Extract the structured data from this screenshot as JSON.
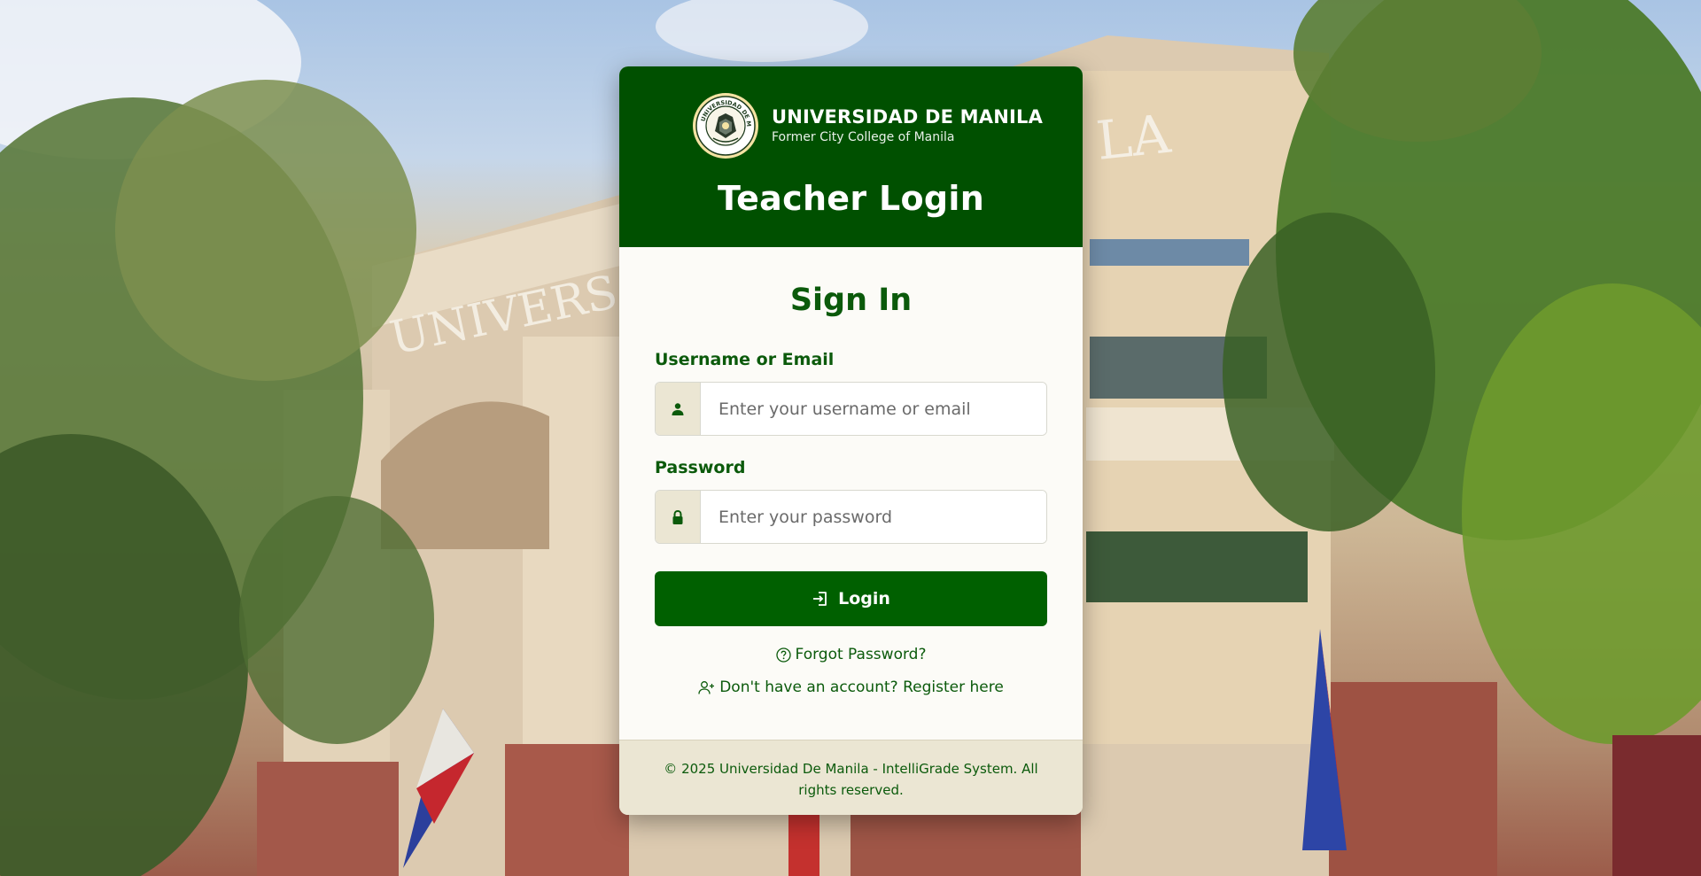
{
  "colors": {
    "primary": "#005000",
    "button": "#006000",
    "text_green": "#0b5a0b",
    "addon_bg": "#ebe6d3",
    "card_bg": "#fcfbf7"
  },
  "header": {
    "university_name": "UNIVERSIDAD DE MANILA",
    "university_subtitle": "Former City College of Manila",
    "title": "Teacher Login",
    "seal_text": "UNIVERSIDAD DE MANILA"
  },
  "form": {
    "heading": "Sign In",
    "username": {
      "label": "Username or Email",
      "placeholder": "Enter your username or email",
      "value": "",
      "icon": "user-icon"
    },
    "password": {
      "label": "Password",
      "placeholder": "Enter your password",
      "value": "",
      "icon": "lock-icon"
    },
    "submit_label": "Login",
    "submit_icon": "login-icon"
  },
  "links": {
    "forgot_password": "Forgot Password?",
    "register": "Don't have an account? Register here"
  },
  "footer": {
    "copyright": "© 2025 Universidad De Manila - IntelliGrade System. All rights reserved."
  }
}
